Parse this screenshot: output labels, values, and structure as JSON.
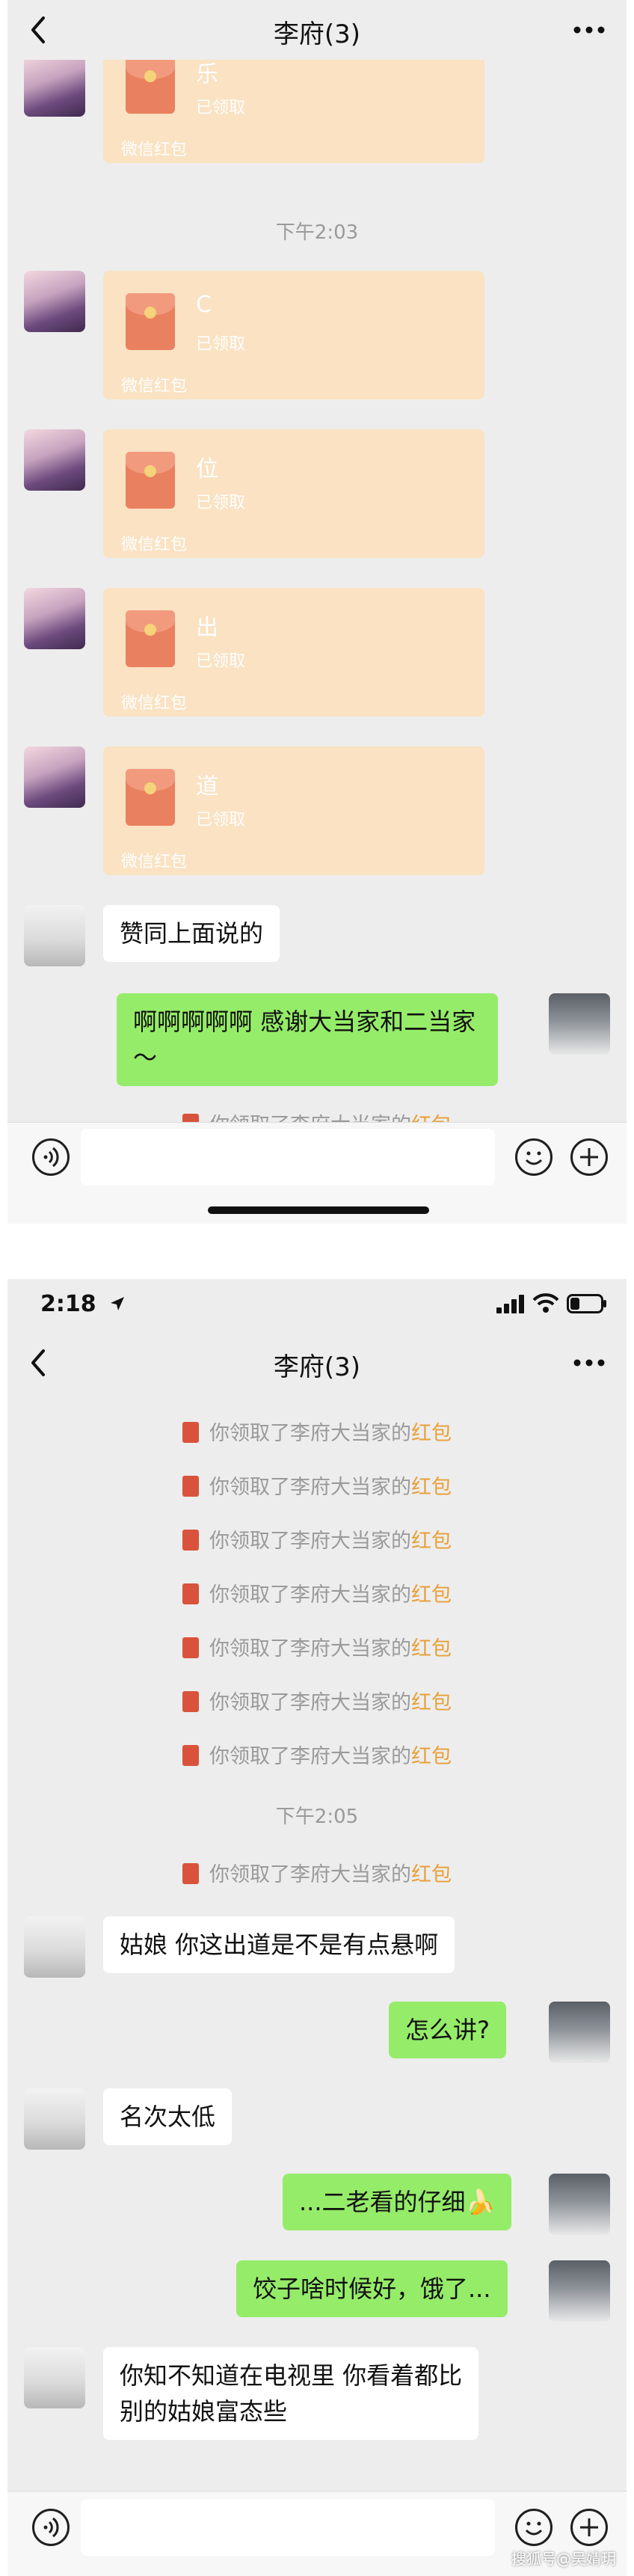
{
  "chat": {
    "title": "李府(3)"
  },
  "status_bar": {
    "time": "2:18"
  },
  "screen1": {
    "red_packets": [
      {
        "message": "乐",
        "status": "已领取",
        "footer": "微信红包"
      },
      {
        "message": "C",
        "status": "已领取",
        "footer": "微信红包"
      },
      {
        "message": "位",
        "status": "已领取",
        "footer": "微信红包"
      },
      {
        "message": "出",
        "status": "已领取",
        "footer": "微信红包"
      },
      {
        "message": "道",
        "status": "已领取",
        "footer": "微信红包"
      }
    ],
    "time_divider": "下午2:03",
    "msg_agree": "赞同上面说的",
    "msg_thanks_line1": "啊啊啊啊啊  感谢大当家和二当家",
    "msg_thanks_line2": "～",
    "received_notice": {
      "prefix": "你领取了李府大当家的",
      "link": "红包"
    }
  },
  "screen2": {
    "received_notice": {
      "prefix": "你领取了李府大当家的",
      "link": "红包"
    },
    "time_divider": "下午2:05",
    "messages": [
      {
        "from": "other",
        "text": "姑娘 你这出道是不是有点悬啊"
      },
      {
        "from": "me",
        "text": "怎么讲?"
      },
      {
        "from": "other",
        "text": "名次太低"
      },
      {
        "from": "me",
        "text": "...二老看的仔细🍌"
      },
      {
        "from": "me",
        "text": "饺子啥时候好，饿了..."
      },
      {
        "from": "other",
        "text_line1": "你知不知道在电视里 你看着都比",
        "text_line2": "别的姑娘富态些"
      }
    ]
  },
  "watermark": "搜狐号@吴婧玥",
  "icons": [
    "back-chevron-icon",
    "more-dots-icon",
    "voice-icon",
    "emoji-icon",
    "add-icon",
    "red-packet-icon",
    "signal-icon",
    "wifi-icon",
    "battery-icon",
    "location-arrow-icon"
  ],
  "colors": {
    "background": "#ededed",
    "my_bubble": "#95ec69",
    "red_packet_card": "#fae2c2",
    "red_packet_envelope": "#e9805f",
    "link_orange": "#e8a038"
  }
}
